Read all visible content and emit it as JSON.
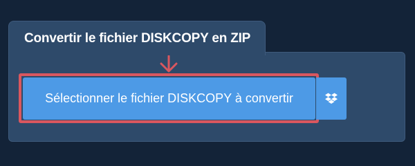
{
  "converter": {
    "title": "Convertir le fichier DISKCOPY en ZIP",
    "select_button_label": "Sélectionner le fichier DISKCOPY à convertir",
    "dropbox_icon": "dropbox-icon"
  },
  "colors": {
    "page_background": "#132338",
    "panel_background": "#2e4a6a",
    "button_background": "#4d9ae6",
    "highlight": "#d9575f"
  }
}
